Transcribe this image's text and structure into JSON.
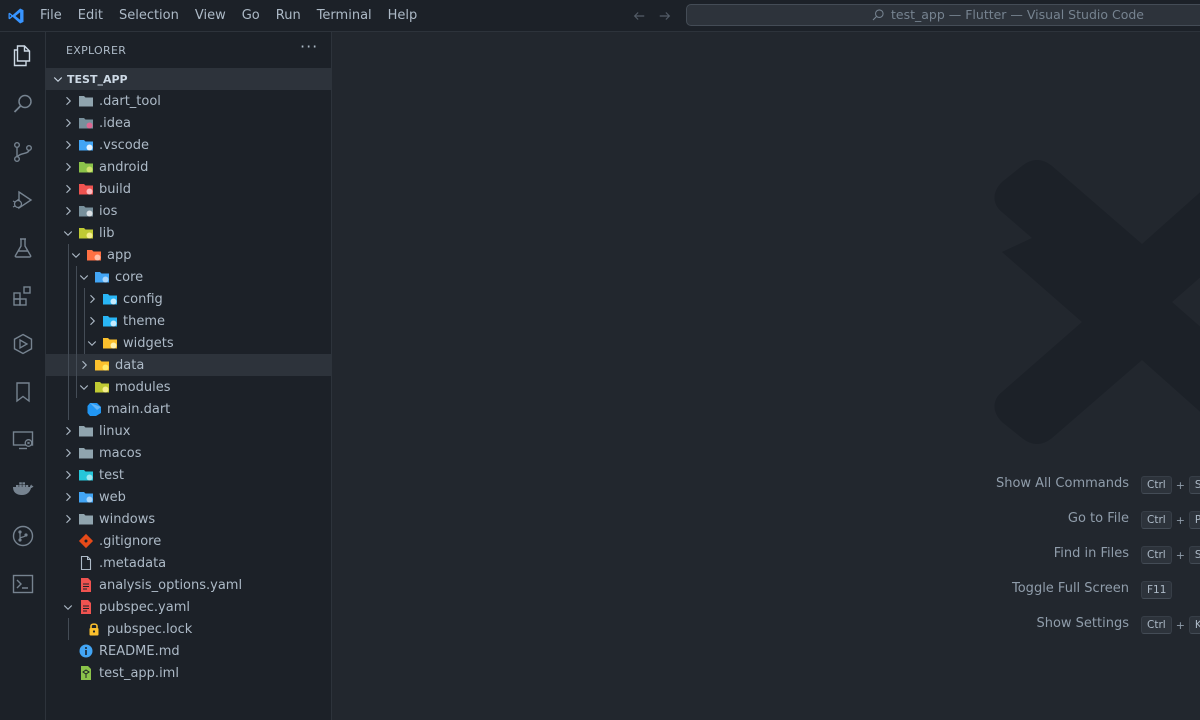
{
  "titlebar": {
    "menu": [
      "File",
      "Edit",
      "Selection",
      "View",
      "Go",
      "Run",
      "Terminal",
      "Help"
    ],
    "command_center_text": "test_app — Flutter — Visual Studio Code"
  },
  "activity_bar": {
    "icons": [
      "explorer-icon",
      "search-icon",
      "source-control-icon",
      "run-debug-icon",
      "testing-icon",
      "extensions-icon",
      "flutter-icon",
      "bookmark-icon",
      "remote-explorer-icon",
      "docker-icon",
      "git-graph-icon",
      "terminal-icon"
    ]
  },
  "explorer": {
    "header": "EXPLORER",
    "root": "TEST_APP",
    "items": [
      {
        "label": ".dart_tool",
        "depth": 0,
        "expanded": false,
        "folder": true,
        "icon": "folder-icon"
      },
      {
        "label": ".idea",
        "depth": 0,
        "expanded": false,
        "folder": true,
        "icon": "folder-idea-icon"
      },
      {
        "label": ".vscode",
        "depth": 0,
        "expanded": false,
        "folder": true,
        "icon": "folder-vscode-icon"
      },
      {
        "label": "android",
        "depth": 0,
        "expanded": false,
        "folder": true,
        "icon": "folder-android-icon"
      },
      {
        "label": "build",
        "depth": 0,
        "expanded": false,
        "folder": true,
        "icon": "folder-build-icon"
      },
      {
        "label": "ios",
        "depth": 0,
        "expanded": false,
        "folder": true,
        "icon": "folder-ios-icon"
      },
      {
        "label": "lib",
        "depth": 0,
        "expanded": true,
        "folder": true,
        "icon": "folder-lib-icon"
      },
      {
        "label": "app",
        "depth": 1,
        "expanded": true,
        "folder": true,
        "icon": "folder-app-icon"
      },
      {
        "label": "core",
        "depth": 2,
        "expanded": true,
        "folder": true,
        "icon": "folder-core-icon"
      },
      {
        "label": "config",
        "depth": 3,
        "expanded": false,
        "folder": true,
        "icon": "folder-config-icon"
      },
      {
        "label": "theme",
        "depth": 3,
        "expanded": false,
        "folder": true,
        "icon": "folder-theme-icon"
      },
      {
        "label": "widgets",
        "depth": 3,
        "expanded": true,
        "folder": true,
        "icon": "folder-widgets-icon"
      },
      {
        "label": "data",
        "depth": 2,
        "expanded": false,
        "folder": true,
        "icon": "folder-data-icon",
        "selected": true
      },
      {
        "label": "modules",
        "depth": 2,
        "expanded": true,
        "folder": true,
        "icon": "folder-modules-icon"
      },
      {
        "label": "main.dart",
        "depth": 1,
        "folder": false,
        "icon": "dart-file-icon"
      },
      {
        "label": "linux",
        "depth": 0,
        "expanded": false,
        "folder": true,
        "icon": "folder-icon"
      },
      {
        "label": "macos",
        "depth": 0,
        "expanded": false,
        "folder": true,
        "icon": "folder-icon"
      },
      {
        "label": "test",
        "depth": 0,
        "expanded": false,
        "folder": true,
        "icon": "folder-test-icon"
      },
      {
        "label": "web",
        "depth": 0,
        "expanded": false,
        "folder": true,
        "icon": "folder-web-icon"
      },
      {
        "label": "windows",
        "depth": 0,
        "expanded": false,
        "folder": true,
        "icon": "folder-icon"
      },
      {
        "label": ".gitignore",
        "depth": 0,
        "folder": false,
        "icon": "git-file-icon"
      },
      {
        "label": ".metadata",
        "depth": 0,
        "folder": false,
        "icon": "generic-file-icon"
      },
      {
        "label": "analysis_options.yaml",
        "depth": 0,
        "folder": false,
        "icon": "yaml-file-icon"
      },
      {
        "label": "pubspec.yaml",
        "depth": 0,
        "expanded": true,
        "folder": false,
        "nestable": true,
        "icon": "yaml-file-icon"
      },
      {
        "label": "pubspec.lock",
        "depth": 1,
        "folder": false,
        "icon": "lock-file-icon"
      },
      {
        "label": "README.md",
        "depth": 0,
        "folder": false,
        "icon": "info-file-icon"
      },
      {
        "label": "test_app.iml",
        "depth": 0,
        "folder": false,
        "icon": "iml-file-icon"
      }
    ]
  },
  "shortcuts": [
    {
      "label": "Show All Commands",
      "keys": [
        "Ctrl",
        "Sh"
      ]
    },
    {
      "label": "Go to File",
      "keys": [
        "Ctrl",
        "P"
      ]
    },
    {
      "label": "Find in Files",
      "keys": [
        "Ctrl",
        "Sh"
      ]
    },
    {
      "label": "Toggle Full Screen",
      "keys": [
        "F11"
      ]
    },
    {
      "label": "Show Settings",
      "keys": [
        "Ctrl",
        "K"
      ]
    }
  ],
  "colors": {
    "background": "#22272e",
    "sidebar": "#1c2128",
    "selection": "#2d333b",
    "text": "#adbac7",
    "accent_blue": "#3794ff"
  }
}
